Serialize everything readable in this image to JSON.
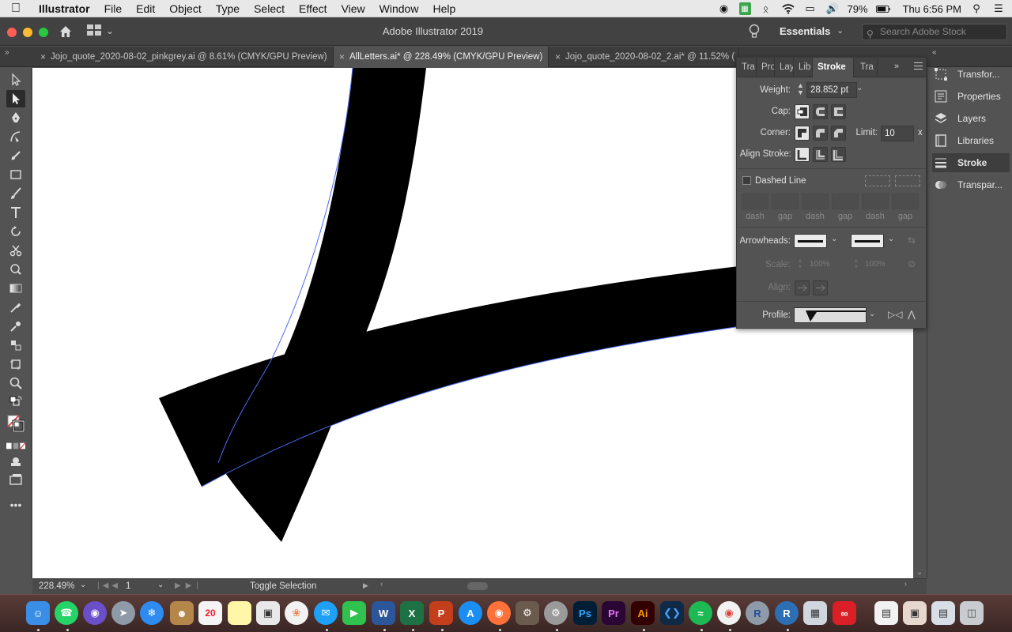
{
  "menubar": {
    "app": "Illustrator",
    "items": [
      "File",
      "Edit",
      "Object",
      "Type",
      "Select",
      "Effect",
      "View",
      "Window",
      "Help"
    ],
    "battery": "79%",
    "clock": "Thu 6:56 PM"
  },
  "appbar": {
    "title": "Adobe Illustrator 2019",
    "workspace": "Essentials",
    "search_placeholder": "Search Adobe Stock"
  },
  "tabs": [
    {
      "label": "Jojo_quote_2020-08-02_pinkgrey.ai @ 8.61% (CMYK/GPU Preview)",
      "active": false
    },
    {
      "label": "AllLetters.ai* @ 228.49% (CMYK/GPU Preview)",
      "active": true
    },
    {
      "label": "Jojo_quote_2020-08-02_2.ai* @ 11.52% (",
      "active": false
    }
  ],
  "status": {
    "zoom": "228.49%",
    "page": "1",
    "info": "Toggle Selection"
  },
  "dock_panels": [
    {
      "label": "Transfor...",
      "icon": "transform-icon"
    },
    {
      "label": "Properties",
      "icon": "properties-icon"
    },
    {
      "label": "Layers",
      "icon": "layers-icon"
    },
    {
      "label": "Libraries",
      "icon": "libraries-icon"
    },
    {
      "label": "Stroke",
      "icon": "stroke-icon",
      "active": true
    },
    {
      "label": "Transpar...",
      "icon": "transparency-icon"
    }
  ],
  "stroke_panel": {
    "tabs": [
      "Tra",
      "Pro",
      "Lay",
      "Lib",
      "Stroke",
      "Tra"
    ],
    "weight_label": "Weight:",
    "weight_value": "28.852 pt",
    "cap_label": "Cap:",
    "corner_label": "Corner:",
    "limit_label": "Limit:",
    "limit_value": "10",
    "limit_unit": "x",
    "align_label": "Align Stroke:",
    "dashed_label": "Dashed Line",
    "dash_labels": [
      "dash",
      "gap",
      "dash",
      "gap",
      "dash",
      "gap"
    ],
    "arrowheads_label": "Arrowheads:",
    "scale_label": "Scale:",
    "scale_value_1": "100%",
    "scale_value_2": "100%",
    "align2_label": "Align:",
    "profile_label": "Profile:"
  },
  "colors": {
    "canvas_bg": "#ffffff",
    "ui_bg": "#535353",
    "selection_outline": "#4a6cf7",
    "artwork_fill": "#000000"
  }
}
